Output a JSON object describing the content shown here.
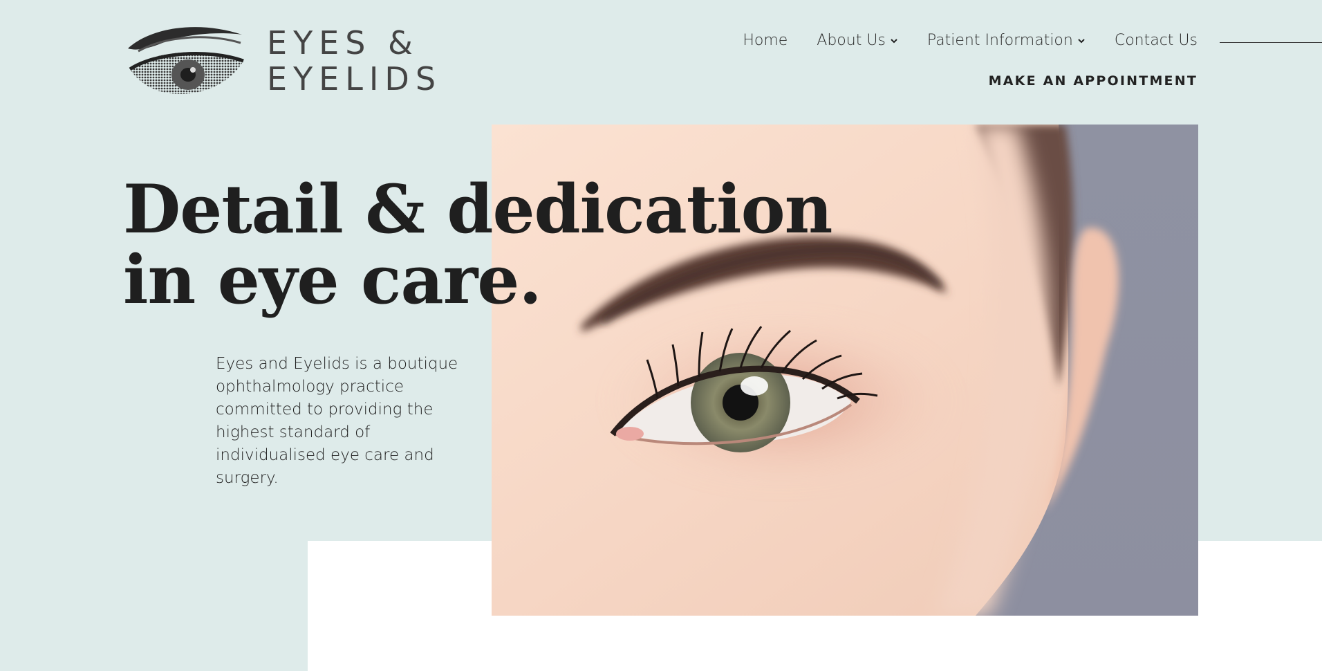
{
  "brand": {
    "line1": "EYES &",
    "line2": "EYELIDS"
  },
  "nav": {
    "items": [
      {
        "label": "Home",
        "has_dropdown": false
      },
      {
        "label": "About Us",
        "has_dropdown": true
      },
      {
        "label": "Patient Information",
        "has_dropdown": true
      },
      {
        "label": "Contact Us",
        "has_dropdown": false
      }
    ],
    "cta": "MAKE AN APPOINTMENT"
  },
  "hero": {
    "headline_line1": "Detail & dedication",
    "headline_line2": "in eye care.",
    "intro": "Eyes and Eyelids is a boutique ophthalmology practice committed to providing the highest standard of individualised eye care and surgery."
  },
  "colors": {
    "background": "#deebea",
    "text": "#222222",
    "white_block": "#ffffff"
  },
  "icons": {
    "logo": "eye-logo-icon",
    "dropdown": "chevron-down-icon"
  }
}
